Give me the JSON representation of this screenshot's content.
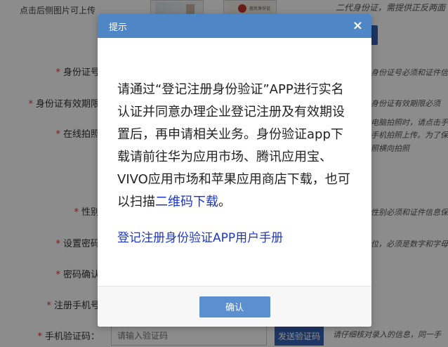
{
  "form": {
    "upload_hint": "点击后侧图片可上传",
    "id_back_text": "居民身份证",
    "top_hint": "二代身份证，需提供正反两面",
    "labels": {
      "id_number": "身份证号",
      "id_validity": "身份证有效期限",
      "online_photo": "在线拍照",
      "gender": "性别",
      "set_password": "设置密码",
      "confirm_password": "密码确认",
      "register_phone": "注册手机号",
      "phone_code": "手机验证码："
    },
    "required_mark": "*",
    "side_notes": {
      "id_number": "身份证号必须和证件信",
      "id_validity": "身份证有效期限必须",
      "photo_1": "电脑拍照时，请点击手",
      "photo_2": "手机拍照上传。为了保",
      "photo_3": "照横向拍照",
      "gender": "性别必须和证件信息保",
      "password": "位，必须是数字和字母"
    },
    "code_input": {
      "placeholder": "请输入验证码"
    },
    "send_code_button": "发送验证码",
    "bottom_note": "请仔细核对录入的信息，同一手"
  },
  "modal": {
    "title": "提示",
    "close_symbol": "×",
    "message_part1": "请通过“登记注册身份验证”APP进行实名认证并同意办理企业登记注册及有效期设置后，再申请相关业务。身份验证app下载请前往华为应用市场、腾讯应用宝、VIVO应用市场和苹果应用商店下载，也可以扫描",
    "qr_link": "二维码下载",
    "message_end": "。",
    "manual_link": "登记注册身份验证APP用户手册",
    "confirm_button": "确认"
  }
}
